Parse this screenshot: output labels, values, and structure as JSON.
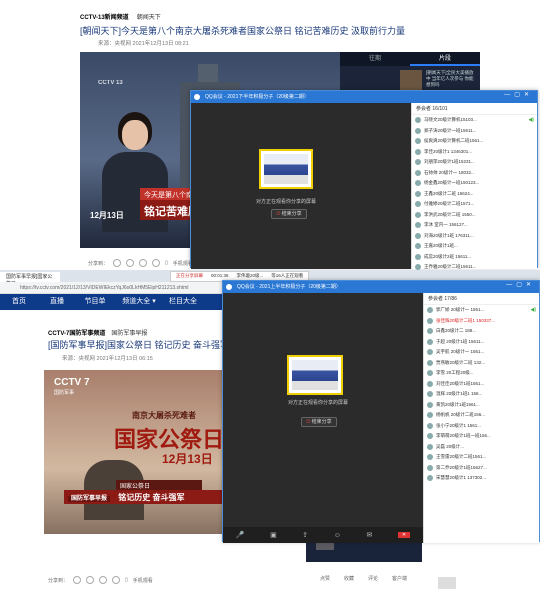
{
  "top": {
    "channel": "CCTV-13新闻频道",
    "section": "朝闻天下",
    "title": "[朝闻天下]今天是第八个南京大屠杀死难者国家公祭日 铭记苦难历史 汲取前行力量",
    "meta": "来源：央视网  2021年12月13日 08:21",
    "video_logo": "CCTV 13",
    "band1": "今天是第八个南京",
    "band2": "铭记苦难历",
    "date": "12月13日",
    "tabs": [
      "往期",
      "片段"
    ],
    "side_item_text": "[朝闻天下]全民大美播放中 当年亿人次参与 你能想到吗",
    "share_label": "分享到：",
    "mobile_label": "手机观看",
    "qq": {
      "title": "QQ会议 - 2021下半年积极分子（20级第二期）",
      "list_head": "参会者 16/101",
      "share_text": "对方正在观看你分享的屏幕",
      "end_btn": "结束分享",
      "members": [
        "马晓文20级计算机15103...",
        "郑子涛20级计一班15611...",
        "侯爽爽20级计算机二班1561...",
        "李佳20级计1 1346301...",
        "刘朋萍20级计1班15231...",
        "石帅帅 20级计一 18032...",
        "杨金鑫20级计一班150123...",
        "王鑫20级计二班 15624...",
        "付雅婷20级计二班1571...",
        "李洪武20级计二班 1550...",
        "李沐 室内一 156127...",
        "刘海20级计1班 176311...",
        "王嘉20级计1班...",
        "成蕊20级计2班 15611...",
        "王乔雅20级计二班15611..."
      ]
    }
  },
  "bottom": {
    "tab_label": "国防军事早报]国家公祭日",
    "share_bar": {
      "status": "正在分享屏幕",
      "time": "00:01:36",
      "speaking": "李伟璇20级...",
      "viewers": "等16人正在观看"
    },
    "url": "https://tv.cctv.com/2021/12/13/VIDEWIEkczYqJ6o0LkHM5ElpH211213.shtml",
    "nav": [
      "首页",
      "直播",
      "节目单",
      "频道大全 ▾",
      "栏目大全"
    ],
    "channel": "CCTV-7国防军事频道",
    "section": "国防军事早报",
    "title": "[国防军事早报]国家公祭日 铭记历史 奋斗强军",
    "meta": "来源：央视网  2021年12月13日 06:15",
    "video_logo": "CCTV 7",
    "video_logo_sub": "国防军事",
    "sub_heading": "南京大屠杀死难者",
    "big_heading": "国家公祭日",
    "date": "12月13日",
    "band1": "国家公祭日",
    "band2_tag": "国防军事早报",
    "band2": "铭记历史 奋斗强军",
    "right_item": "[国防军事早报]直击演习实训 家园绝地 地方英国后北军 运输直升机运动",
    "share_label": "分享到：",
    "mobile_label": "手机观看",
    "actions": [
      "点赞",
      "收藏",
      "评论",
      "客户端"
    ],
    "qq": {
      "title": "QQ会议 - 2021上半年积极分子（20级第二期）",
      "list_head": "参会者 17/86",
      "share_text": "对方正在观看你分享的屏幕",
      "end_btn": "结束分享",
      "members": [
        "郭广娇 20级计一 1561...",
        "张佳辉20级计二班1 150337...",
        "白鑫20级计二 188...",
        "于超 20级计1班 15611...",
        "吴宇航 20级计一 1561...",
        "贾燕敏20级计二班 132...",
        "李雪 20工程20级...",
        "刘佳佳20级计1班1561...",
        "温辉 20级计1班1 156...",
        "黄凯20级计1班1561...",
        "杨帆帆 20级计二班156...",
        "张小宁20级计1 1561...",
        "李萌萌20级计1班一班156...",
        "吴磊 20级计...",
        "王雪雷20级计二班1561...",
        "第二乔20级计1班15627...",
        "宋慧慧20级计1 137302..."
      ]
    }
  }
}
